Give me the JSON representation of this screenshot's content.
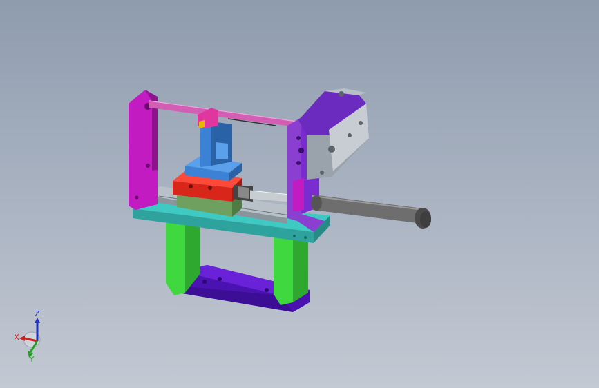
{
  "triad": {
    "x_label": "X",
    "y_label": "Y",
    "z_label": "Z",
    "x_color": "#d02020",
    "y_color": "#20a020",
    "z_color": "#2030c0"
  },
  "colors": {
    "frame_magenta": "#c21bc2",
    "stepper_purple": "#7a2ccf",
    "legs_green": "#3fd93f",
    "base_violet": "#5a17c9",
    "plate_teal": "#3fc9c3",
    "block_red": "#d9261a",
    "block_green": "#6fa060",
    "bracket_blue": "#3b82d6",
    "rod_pink": "#d35fb4",
    "cylinder_gray": "#6e6e6e"
  }
}
